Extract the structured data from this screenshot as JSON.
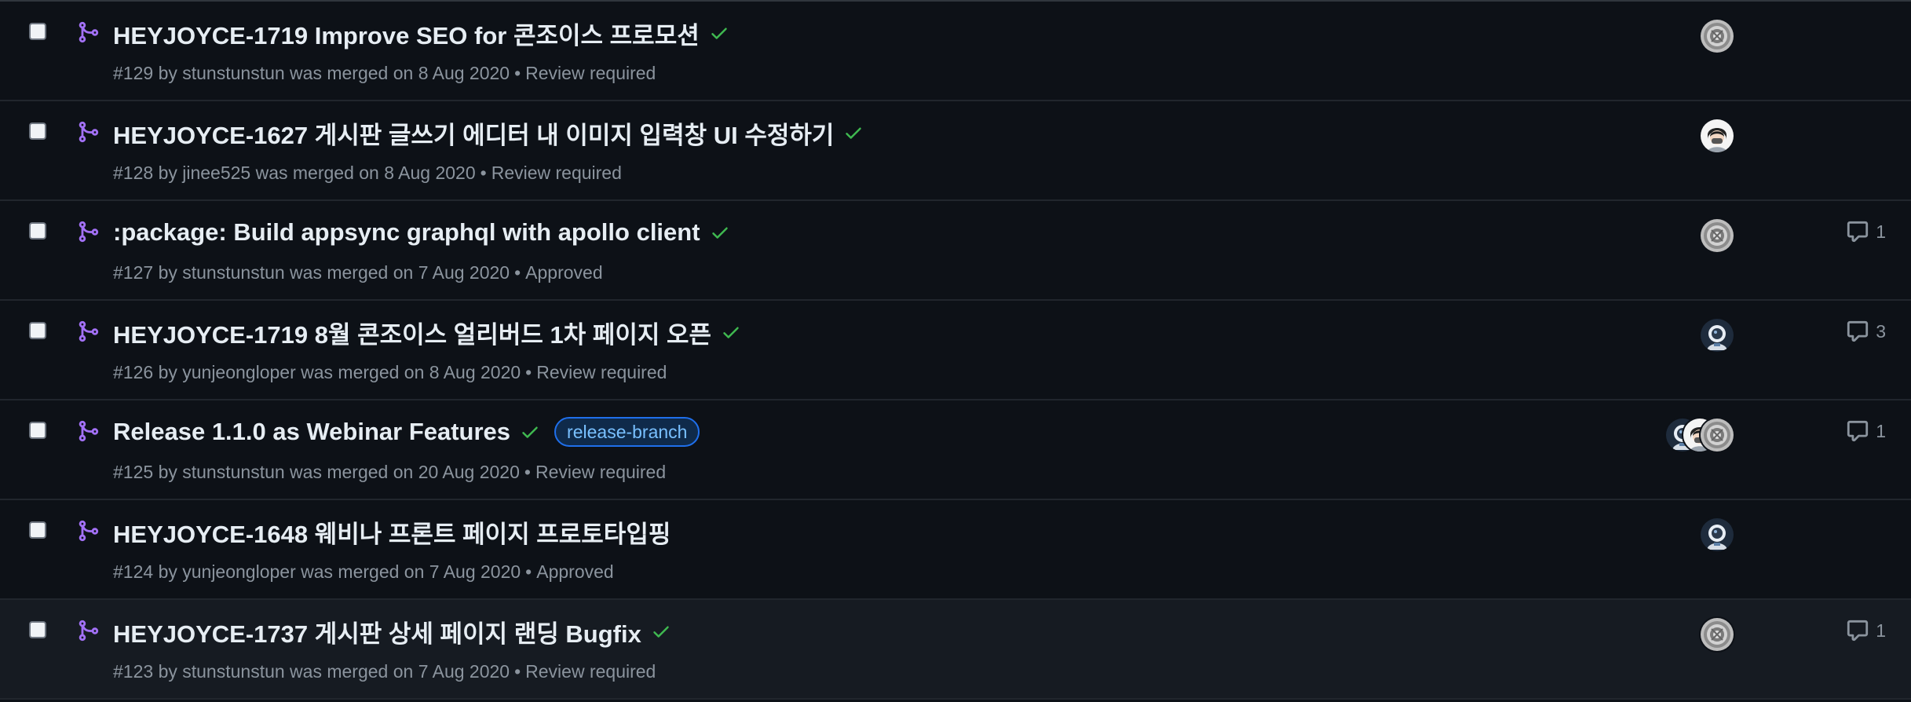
{
  "rows": [
    {
      "title": "HEYJOYCE-1719 Improve SEO for 콘조이스 프로모션",
      "number": "#129",
      "meta": "by stunstunstun was merged on 8 Aug 2020",
      "review": "Review required",
      "status_check": true,
      "label": null,
      "avatars": [
        "gray"
      ],
      "comments": null
    },
    {
      "title": "HEYJOYCE-1627 게시판 글쓰기 에디터 내 이미지 입력창 UI 수정하기",
      "number": "#128",
      "meta": "by jinee525 was merged on 8 Aug 2020",
      "review": "Review required",
      "status_check": true,
      "label": null,
      "avatars": [
        "girl"
      ],
      "comments": null
    },
    {
      "title": ":package: Build appsync graphql with apollo client",
      "number": "#127",
      "meta": "by stunstunstun was merged on 7 Aug 2020",
      "review": "Approved",
      "status_check": true,
      "label": null,
      "avatars": [
        "gray"
      ],
      "comments": "1"
    },
    {
      "title": "HEYJOYCE-1719 8월 콘조이스 얼리버드 1차 페이지 오픈",
      "number": "#126",
      "meta": "by yunjeongloper was merged on 8 Aug 2020",
      "review": "Review required",
      "status_check": true,
      "label": null,
      "avatars": [
        "astro"
      ],
      "comments": "3"
    },
    {
      "title": "Release 1.1.0 as Webinar Features",
      "number": "#125",
      "meta": "by stunstunstun was merged on 20 Aug 2020",
      "review": "Review required",
      "status_check": true,
      "label": "release-branch",
      "avatars": [
        "astro",
        "girl",
        "gray"
      ],
      "comments": "1"
    },
    {
      "title": "HEYJOYCE-1648 웨비나 프론트 페이지 프로토타입핑",
      "number": "#124",
      "meta": "by yunjeongloper was merged on 7 Aug 2020",
      "review": "Approved",
      "status_check": false,
      "label": null,
      "avatars": [
        "astro"
      ],
      "comments": null
    },
    {
      "title": "HEYJOYCE-1737 게시판 상세 페이지 랜딩 Bugfix",
      "number": "#123",
      "meta": "by stunstunstun was merged on 7 Aug 2020",
      "review": "Review required",
      "status_check": true,
      "label": null,
      "avatars": [
        "gray"
      ],
      "comments": "1"
    }
  ],
  "colors": {
    "background": "#0d1117",
    "title": "#e6edf3",
    "meta": "#8b949e",
    "merged_icon": "#a371f7",
    "check": "#3fb950",
    "label_text": "#79c0ff"
  },
  "icons": {
    "merged": "git-merge-icon",
    "status": "check-icon",
    "comment": "comment-icon"
  }
}
